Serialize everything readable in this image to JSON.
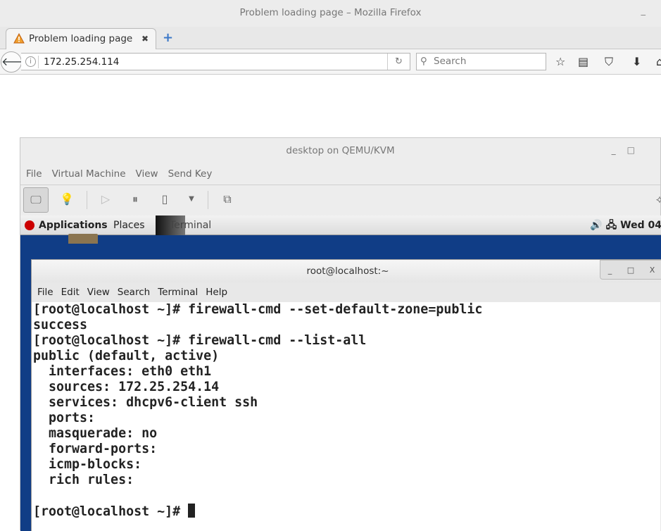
{
  "browser": {
    "window_title": "Problem loading page – Mozilla Firefox",
    "tab_label": "Problem loading page",
    "url": "172.25.254.114",
    "search_placeholder": "Search"
  },
  "vm": {
    "window_title": "desktop on QEMU/KVM",
    "menu": [
      "File",
      "Virtual Machine",
      "View",
      "Send Key"
    ]
  },
  "guest": {
    "topbar": {
      "applications": "Applications",
      "places": "Places",
      "terminal": "Terminal",
      "clock": "Wed 04"
    }
  },
  "terminal": {
    "title": "root@localhost:~",
    "menu": [
      "File",
      "Edit",
      "View",
      "Search",
      "Terminal",
      "Help"
    ],
    "lines": [
      "[root@localhost ~]# firewall-cmd --set-default-zone=public",
      "success",
      "[root@localhost ~]# firewall-cmd --list-all",
      "public (default, active)",
      "  interfaces: eth0 eth1",
      "  sources: 172.25.254.14",
      "  services: dhcpv6-client ssh",
      "  ports: ",
      "  masquerade: no",
      "  forward-ports: ",
      "  icmp-blocks: ",
      "  rich rules: ",
      ""
    ],
    "prompt": "[root@localhost ~]# "
  }
}
